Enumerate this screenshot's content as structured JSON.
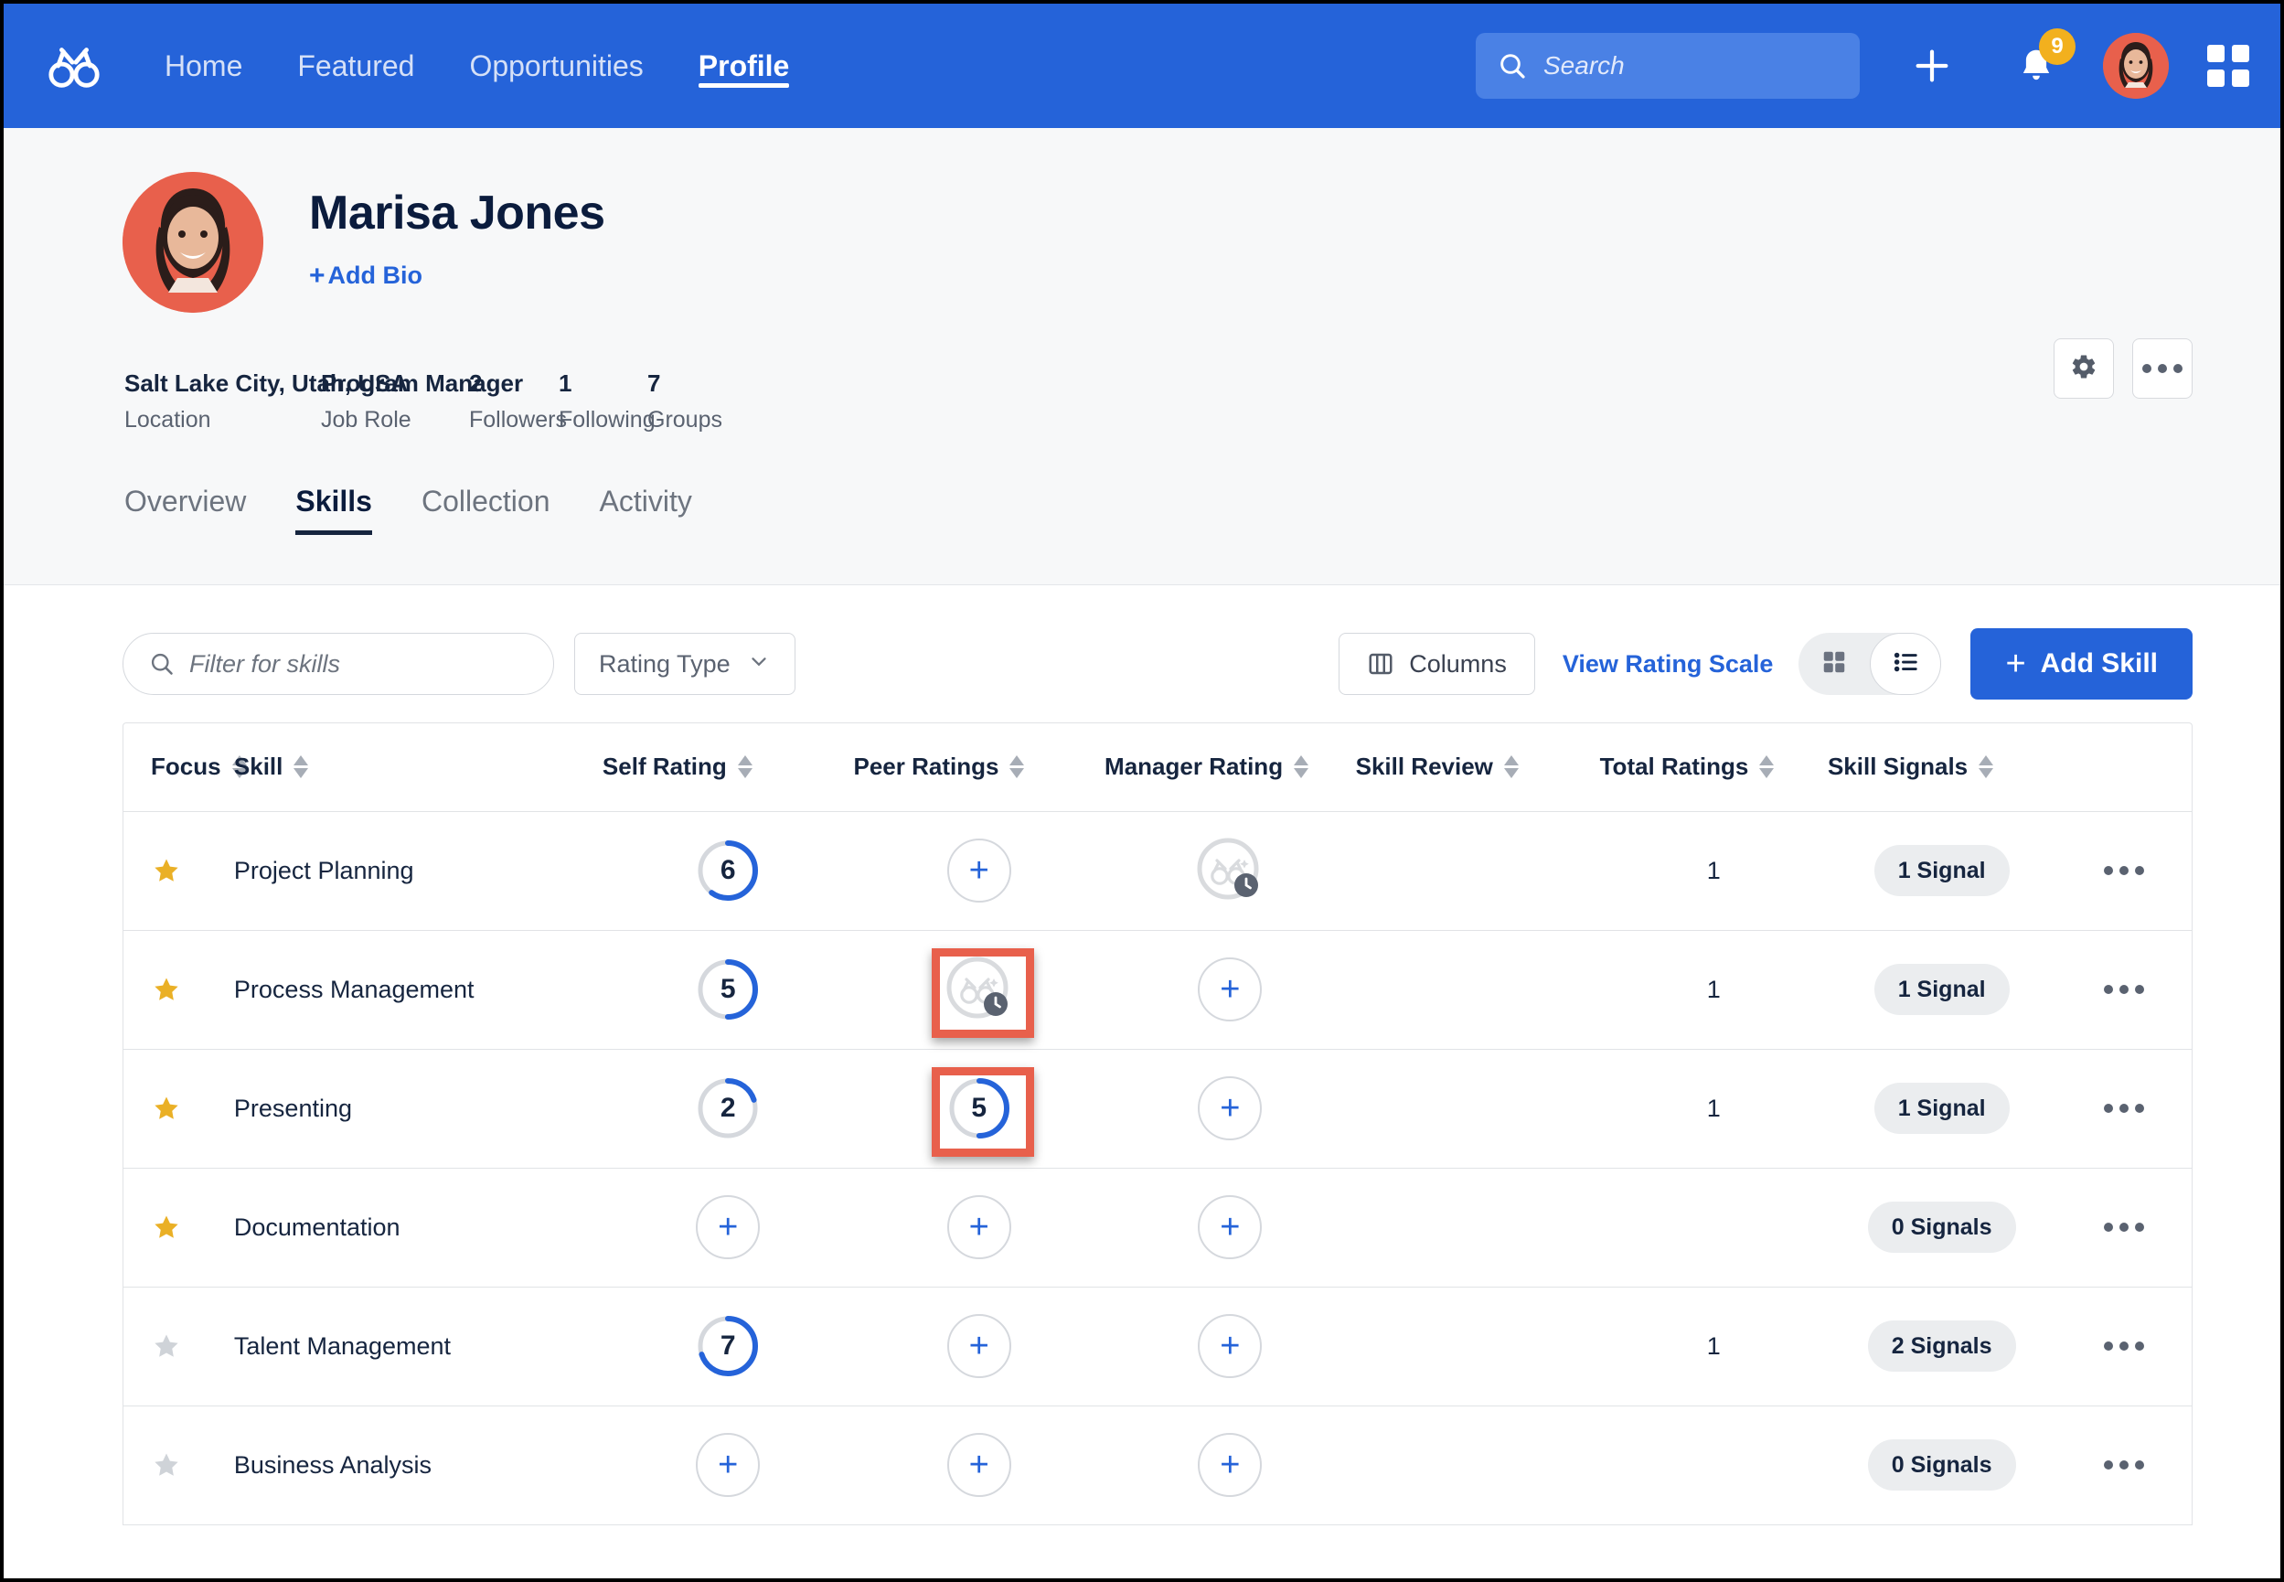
{
  "nav": {
    "logo_icon": "glasses-logo-icon",
    "links": [
      {
        "label": "Home",
        "active": false
      },
      {
        "label": "Featured",
        "active": false
      },
      {
        "label": "Opportunities",
        "active": false
      },
      {
        "label": "Profile",
        "active": true
      }
    ],
    "search": {
      "placeholder": "Search",
      "value": "",
      "icon": "search-icon"
    },
    "add_icon": "plus-icon",
    "notifications": {
      "icon": "bell-icon",
      "count": "9"
    },
    "avatar_icon": "user-avatar",
    "apps_icon": "app-grid-icon",
    "brand_color": "#2563d9"
  },
  "profile": {
    "name": "Marisa Jones",
    "add_bio": {
      "plus": "+",
      "label": "Add Bio"
    },
    "settings_icon": "gear-icon",
    "more_icon": "ellipsis-icon",
    "meta": [
      {
        "value": "Salt Lake City, Utah, USA",
        "label": "Location"
      },
      {
        "value": "Program Manager",
        "label": "Job Role"
      },
      {
        "value": "2",
        "label": "Followers"
      },
      {
        "value": "1",
        "label": "Following"
      },
      {
        "value": "7",
        "label": "Groups"
      }
    ],
    "tabs": [
      {
        "label": "Overview",
        "active": false
      },
      {
        "label": "Skills",
        "active": true
      },
      {
        "label": "Collection",
        "active": false
      },
      {
        "label": "Activity",
        "active": false
      }
    ]
  },
  "toolbar": {
    "filter_placeholder": "Filter for skills",
    "filter_value": "",
    "filter_icon": "search-icon",
    "rating_type_label": "Rating Type",
    "rating_type_icon": "chevron-down-icon",
    "columns_label": "Columns",
    "columns_icon": "columns-icon",
    "view_rating_scale_label": "View Rating Scale",
    "view_grid_icon": "grid-view-icon",
    "view_list_icon": "list-view-icon",
    "view_selected": "list",
    "add_skill_plus": "+",
    "add_skill_label": "Add Skill",
    "accent_color": "#2563d9"
  },
  "table": {
    "columns": [
      {
        "label": "Focus",
        "sortable": true
      },
      {
        "label": "Skill",
        "sortable": true
      },
      {
        "label": "Self Rating",
        "sortable": true
      },
      {
        "label": "Peer Ratings",
        "sortable": true
      },
      {
        "label": "Manager Rating",
        "sortable": true
      },
      {
        "label": "Skill Review",
        "sortable": true
      },
      {
        "label": "Total Ratings",
        "sortable": true
      },
      {
        "label": "Skill Signals",
        "sortable": true
      }
    ],
    "rows": [
      {
        "focus": "starred",
        "skill": "Project Planning",
        "self_rating": {
          "type": "value",
          "value": "6",
          "max": 10
        },
        "peer_rating": {
          "type": "add",
          "label": "+"
        },
        "manager_rating": {
          "type": "pending",
          "icon": "pending-rating-icon"
        },
        "skill_review": "",
        "total_ratings": "1",
        "skill_signals": "1 Signal",
        "actions_icon": "ellipsis-icon"
      },
      {
        "focus": "starred",
        "skill": "Process Management",
        "self_rating": {
          "type": "value",
          "value": "5",
          "max": 10
        },
        "peer_rating": {
          "type": "pending",
          "icon": "pending-rating-icon",
          "highlighted": true
        },
        "manager_rating": {
          "type": "add",
          "label": "+"
        },
        "skill_review": "",
        "total_ratings": "1",
        "skill_signals": "1 Signal",
        "actions_icon": "ellipsis-icon"
      },
      {
        "focus": "starred",
        "skill": "Presenting",
        "self_rating": {
          "type": "value",
          "value": "2",
          "max": 10
        },
        "peer_rating": {
          "type": "value",
          "value": "5",
          "max": 10,
          "highlighted": true
        },
        "manager_rating": {
          "type": "add",
          "label": "+"
        },
        "skill_review": "",
        "total_ratings": "1",
        "skill_signals": "1 Signal",
        "actions_icon": "ellipsis-icon"
      },
      {
        "focus": "starred",
        "skill": "Documentation",
        "self_rating": {
          "type": "add",
          "label": "+"
        },
        "peer_rating": {
          "type": "add",
          "label": "+"
        },
        "manager_rating": {
          "type": "add",
          "label": "+"
        },
        "skill_review": "",
        "total_ratings": "",
        "skill_signals": "0 Signals",
        "actions_icon": "ellipsis-icon"
      },
      {
        "focus": "unstarred",
        "skill": "Talent Management",
        "self_rating": {
          "type": "value",
          "value": "7",
          "max": 10
        },
        "peer_rating": {
          "type": "add",
          "label": "+"
        },
        "manager_rating": {
          "type": "add",
          "label": "+"
        },
        "skill_review": "",
        "total_ratings": "1",
        "skill_signals": "2 Signals",
        "actions_icon": "ellipsis-icon"
      },
      {
        "focus": "unstarred",
        "skill": "Business Analysis",
        "self_rating": {
          "type": "add",
          "label": "+"
        },
        "peer_rating": {
          "type": "add",
          "label": "+"
        },
        "manager_rating": {
          "type": "add",
          "label": "+"
        },
        "skill_review": "",
        "total_ratings": "",
        "skill_signals": "0 Signals",
        "actions_icon": "ellipsis-icon"
      }
    ]
  },
  "highlight_color": "#e8604c",
  "star_color": "#eab026"
}
